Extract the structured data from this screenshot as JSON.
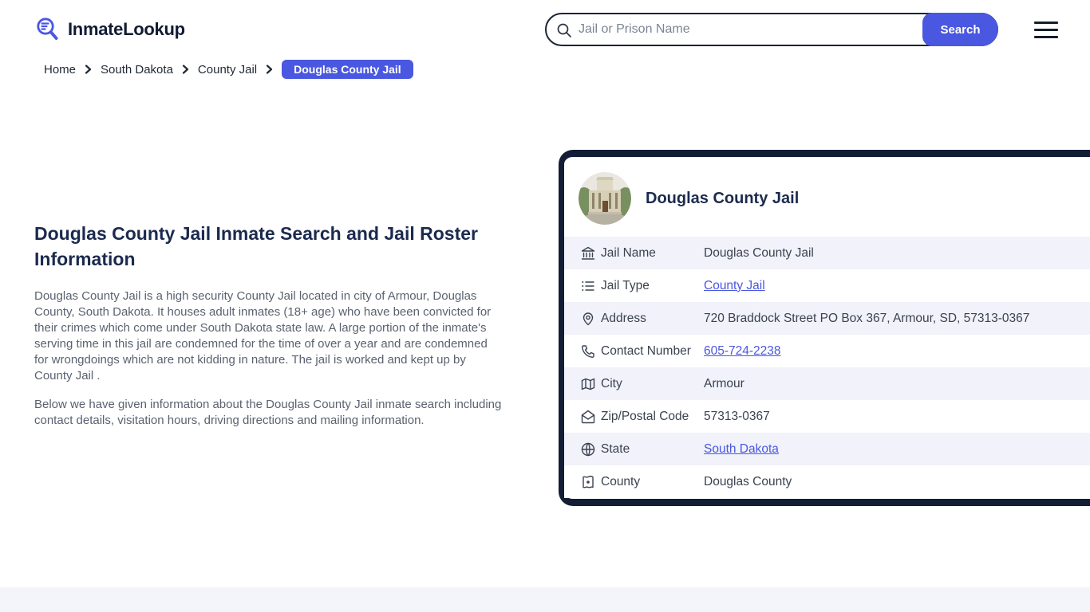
{
  "header": {
    "logo_text": "InmateLookup",
    "search": {
      "placeholder": "Jail or Prison Name",
      "button_label": "Search"
    }
  },
  "breadcrumb": {
    "items": [
      "Home",
      "South Dakota",
      "County Jail"
    ],
    "current": "Douglas County Jail"
  },
  "article": {
    "heading": "Douglas County Jail Inmate Search and Jail Roster Information",
    "paragraphs": [
      "Douglas County Jail is a high security County Jail located in city of Armour, Douglas County, South Dakota. It houses adult inmates (18+ age) who have been convicted for their crimes which come under South Dakota state law. A large portion of the inmate's serving time in this jail are condemned for the time of over a year and are condemned for wrongdoings which are not kidding in nature. The jail is worked and kept up by County Jail .",
      "Below we have given information about the Douglas County Jail inmate search including contact details, visitation hours, driving directions and mailing information."
    ]
  },
  "jail_card": {
    "title": "Douglas County Jail",
    "photo_alt": "douglas-county-jail-building",
    "rows": [
      {
        "icon": "landmark-icon",
        "label": "Jail Name",
        "value": "Douglas County Jail",
        "link": false
      },
      {
        "icon": "list-icon",
        "label": "Jail Type",
        "value": "County Jail",
        "link": true
      },
      {
        "icon": "map-pin-icon",
        "label": "Address",
        "value": "720 Braddock Street PO Box 367, Armour, SD, 57313-0367",
        "link": false
      },
      {
        "icon": "phone-icon",
        "label": "Contact Number",
        "value": "605-724-2238",
        "link": true
      },
      {
        "icon": "map-icon",
        "label": "City",
        "value": "Armour",
        "link": false
      },
      {
        "icon": "envelope-open-icon",
        "label": "Zip/Postal Code",
        "value": "57313-0367",
        "link": false
      },
      {
        "icon": "globe-icon",
        "label": "State",
        "value": "South Dakota",
        "link": true
      },
      {
        "icon": "county-map-icon",
        "label": "County",
        "value": "Douglas County",
        "link": false
      }
    ]
  },
  "colors": {
    "accent_blue": "#4a57e0",
    "navy": "#141d36",
    "row_alt_bg": "#f1f2fa",
    "footer_bg": "#f4f5fb",
    "body_text": "#5a6270"
  }
}
